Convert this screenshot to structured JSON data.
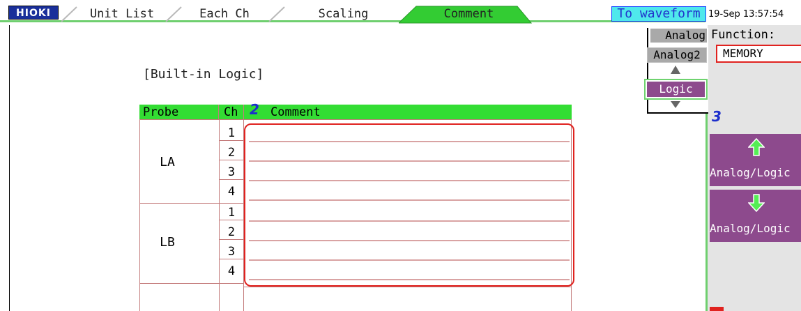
{
  "header": {
    "logo": "HIOKI",
    "tabs": [
      {
        "label": "Unit List",
        "active": false
      },
      {
        "label": "Each Ch",
        "active": false
      },
      {
        "label": "Scaling",
        "active": false
      },
      {
        "label": "Comment",
        "active": true
      }
    ],
    "to_waveform_label": "To waveform",
    "datetime": "19-Sep 13:57:54"
  },
  "main": {
    "section_title": "[Built-in Logic]",
    "table": {
      "headers": {
        "probe": "Probe",
        "ch": "Ch",
        "comment": "Comment"
      },
      "groups": [
        {
          "probe": "LA",
          "channels": [
            "1",
            "2",
            "3",
            "4"
          ],
          "comments": [
            "",
            "",
            "",
            ""
          ]
        },
        {
          "probe": "LB",
          "channels": [
            "1",
            "2",
            "3",
            "4"
          ],
          "comments": [
            "",
            "",
            "",
            ""
          ]
        }
      ]
    },
    "markers": {
      "comment_marker": "2",
      "selector_marker": "3"
    }
  },
  "channel_selector": {
    "analog": "Analog",
    "analog2": "Analog2",
    "logic": "Logic"
  },
  "function": {
    "label": "Function:",
    "value": "MEMORY",
    "buttons": [
      {
        "label": "Analog/Logic",
        "icon": "arrow-up-icon"
      },
      {
        "label": "Analog/Logic",
        "icon": "arrow-down-icon"
      }
    ]
  },
  "colors": {
    "active_tab": "#33cc33",
    "header_green": "#33dd33",
    "accent_purple": "#8d4a8d",
    "highlight_red": "#e0221f",
    "to_waveform_bg": "#4fe8ec",
    "marker_blue": "#1d2fcc"
  }
}
